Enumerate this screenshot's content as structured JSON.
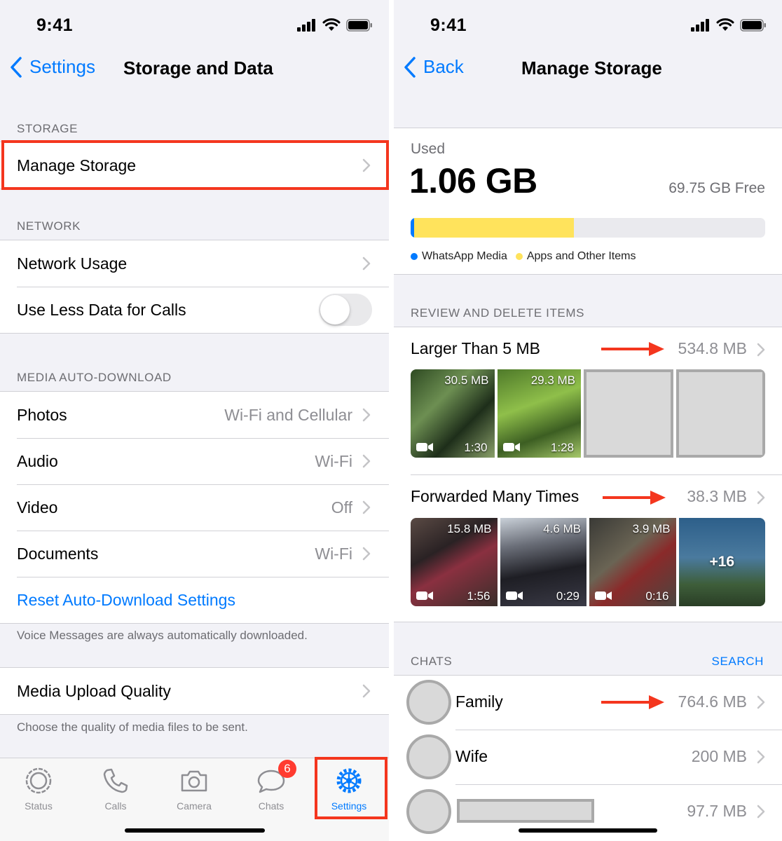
{
  "colors": {
    "accent": "#007aff",
    "highlight": "#f4361e",
    "whatsapp_media": "#007aff",
    "apps_other": "#ffe35c",
    "badge": "#ff3b30"
  },
  "left_screen": {
    "status_time": "9:41",
    "back_label": "Settings",
    "title": "Storage and Data",
    "storage": {
      "header": "STORAGE",
      "manage_storage": "Manage Storage"
    },
    "network": {
      "header": "NETWORK",
      "network_usage": "Network Usage",
      "use_less_data": "Use Less Data for Calls",
      "use_less_data_enabled": false
    },
    "media_auto_download": {
      "header": "MEDIA AUTO-DOWNLOAD",
      "items": [
        {
          "label": "Photos",
          "value": "Wi-Fi and Cellular"
        },
        {
          "label": "Audio",
          "value": "Wi-Fi"
        },
        {
          "label": "Video",
          "value": "Off"
        },
        {
          "label": "Documents",
          "value": "Wi-Fi"
        }
      ],
      "reset_label": "Reset Auto-Download Settings",
      "footer": "Voice Messages are always automatically downloaded."
    },
    "upload_quality": {
      "label": "Media Upload Quality",
      "footer": "Choose the quality of media files to be sent."
    },
    "tabbar": {
      "tabs": [
        {
          "label": "Status",
          "icon": "status-ring-icon"
        },
        {
          "label": "Calls",
          "icon": "phone-icon"
        },
        {
          "label": "Camera",
          "icon": "camera-icon"
        },
        {
          "label": "Chats",
          "icon": "chat-bubble-icon",
          "badge": "6"
        },
        {
          "label": "Settings",
          "icon": "gear-icon",
          "active": true
        }
      ]
    }
  },
  "right_screen": {
    "status_time": "9:41",
    "back_label": "Back",
    "title": "Manage Storage",
    "usage": {
      "used_label": "Used",
      "used_value": "1.06 GB",
      "free_value": "69.75 GB Free",
      "whatsapp_media_fraction": 0.01,
      "apps_other_fraction": 0.45,
      "legend": [
        "WhatsApp Media",
        "Apps and Other Items"
      ]
    },
    "review": {
      "header": "REVIEW AND DELETE ITEMS",
      "larger_than": {
        "title": "Larger Than 5 MB",
        "size": "534.8 MB",
        "thumbs": [
          {
            "size": "30.5 MB",
            "duration": "1:30"
          },
          {
            "size": "29.3 MB",
            "duration": "1:28"
          }
        ]
      },
      "forwarded": {
        "title": "Forwarded Many Times",
        "size": "38.3 MB",
        "thumbs": [
          {
            "size": "15.8 MB",
            "duration": "1:56"
          },
          {
            "size": "4.6 MB",
            "duration": "0:29"
          },
          {
            "size": "3.9 MB",
            "duration": "0:16"
          }
        ],
        "more": "+16"
      }
    },
    "chats": {
      "header": "CHATS",
      "search": "SEARCH",
      "items": [
        {
          "name": "Family",
          "size": "764.6 MB"
        },
        {
          "name": "Wife",
          "size": "200 MB"
        },
        {
          "name": "",
          "size": "97.7 MB"
        }
      ]
    }
  }
}
